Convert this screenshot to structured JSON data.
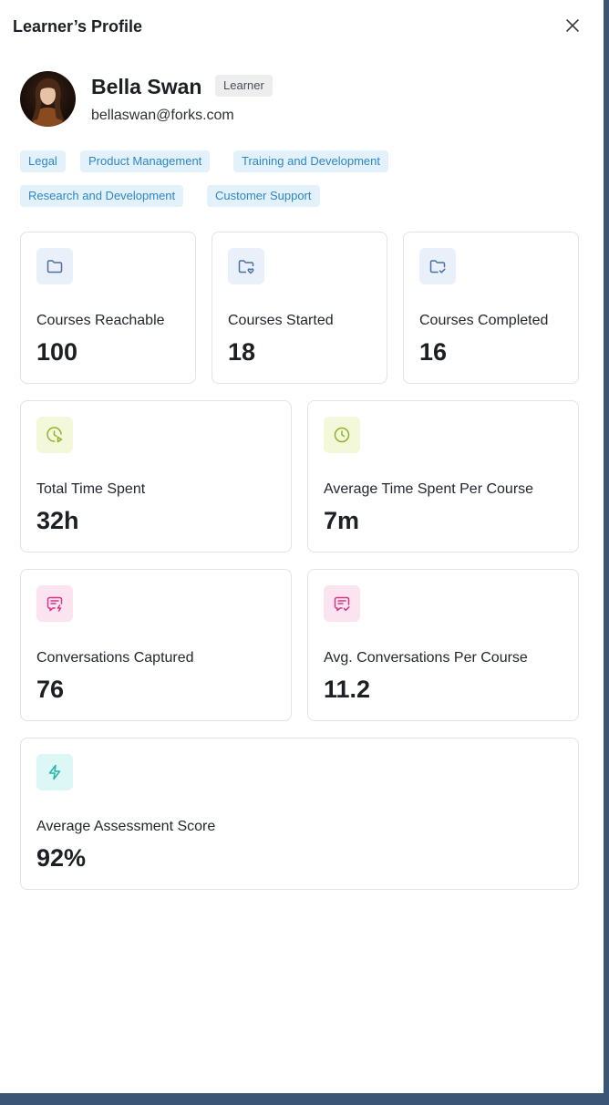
{
  "header": {
    "title": "Learner’s Profile"
  },
  "profile": {
    "name": "Bella Swan",
    "role": "Learner",
    "email": "bellaswan@forks.com"
  },
  "tags": [
    "Legal",
    "Product Management",
    "Training and Development",
    "Research and Development",
    "Customer Support"
  ],
  "stats": {
    "courses_reachable": {
      "label": "Courses Reachable",
      "value": "100",
      "icon": "folder-icon"
    },
    "courses_started": {
      "label": "Courses Started",
      "value": "18",
      "icon": "folder-heart-icon"
    },
    "courses_completed": {
      "label": "Courses Completed",
      "value": "16",
      "icon": "folder-check-icon"
    },
    "total_time": {
      "label": "Total Time Spent",
      "value": "32h",
      "icon": "clock-play-icon"
    },
    "avg_time": {
      "label": "Average Time Spent Per Course",
      "value": "7m",
      "icon": "clock-icon"
    },
    "conversations": {
      "label": "Conversations Captured",
      "value": "76",
      "icon": "message-bolt-icon"
    },
    "avg_conversations": {
      "label": "Avg. Conversations Per Course",
      "value": "11.2",
      "icon": "message-check-icon"
    },
    "assessment": {
      "label": "Average Assessment Score",
      "value": "92%",
      "icon": "bolt-icon"
    }
  },
  "colors": {
    "tag_bg": "#e3f1fb",
    "tag_text": "#2f86c4",
    "icon_blue": "#4a6fa5",
    "icon_green": "#8fb12a",
    "icon_pink": "#d4378a",
    "icon_teal": "#24b3ad",
    "backdrop": "#3a5575"
  }
}
